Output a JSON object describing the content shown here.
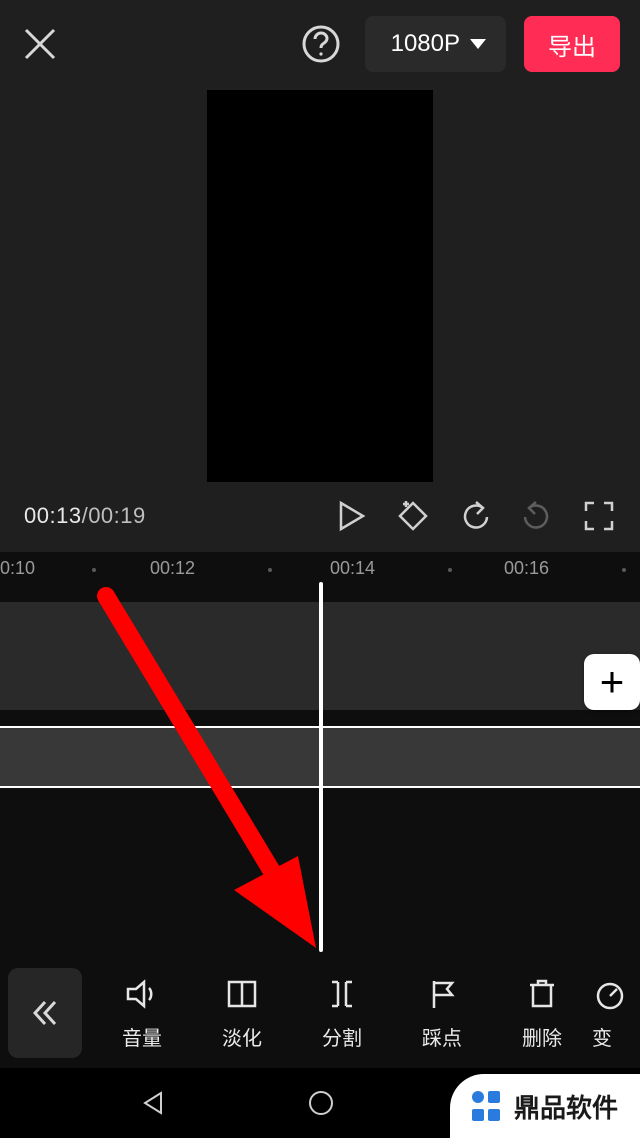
{
  "topbar": {
    "resolution_label": "1080P",
    "export_label": "导出"
  },
  "transport": {
    "time_current": "00:13",
    "time_separator": "/",
    "time_total": "00:19"
  },
  "ruler": {
    "ticks": [
      "0:10",
      "00:12",
      "00:14",
      "00:16"
    ]
  },
  "tools": {
    "items": [
      {
        "key": "volume",
        "label": "音量"
      },
      {
        "key": "fade",
        "label": "淡化"
      },
      {
        "key": "split",
        "label": "分割"
      },
      {
        "key": "beat",
        "label": "踩点"
      },
      {
        "key": "delete",
        "label": "删除"
      },
      {
        "key": "speed",
        "label": "变"
      }
    ]
  },
  "watermark": {
    "text": "鼎品软件"
  },
  "colors": {
    "accent": "#ff2d55",
    "waveform": "#35e4e0"
  },
  "annotation": {
    "arrow_target": "split"
  }
}
